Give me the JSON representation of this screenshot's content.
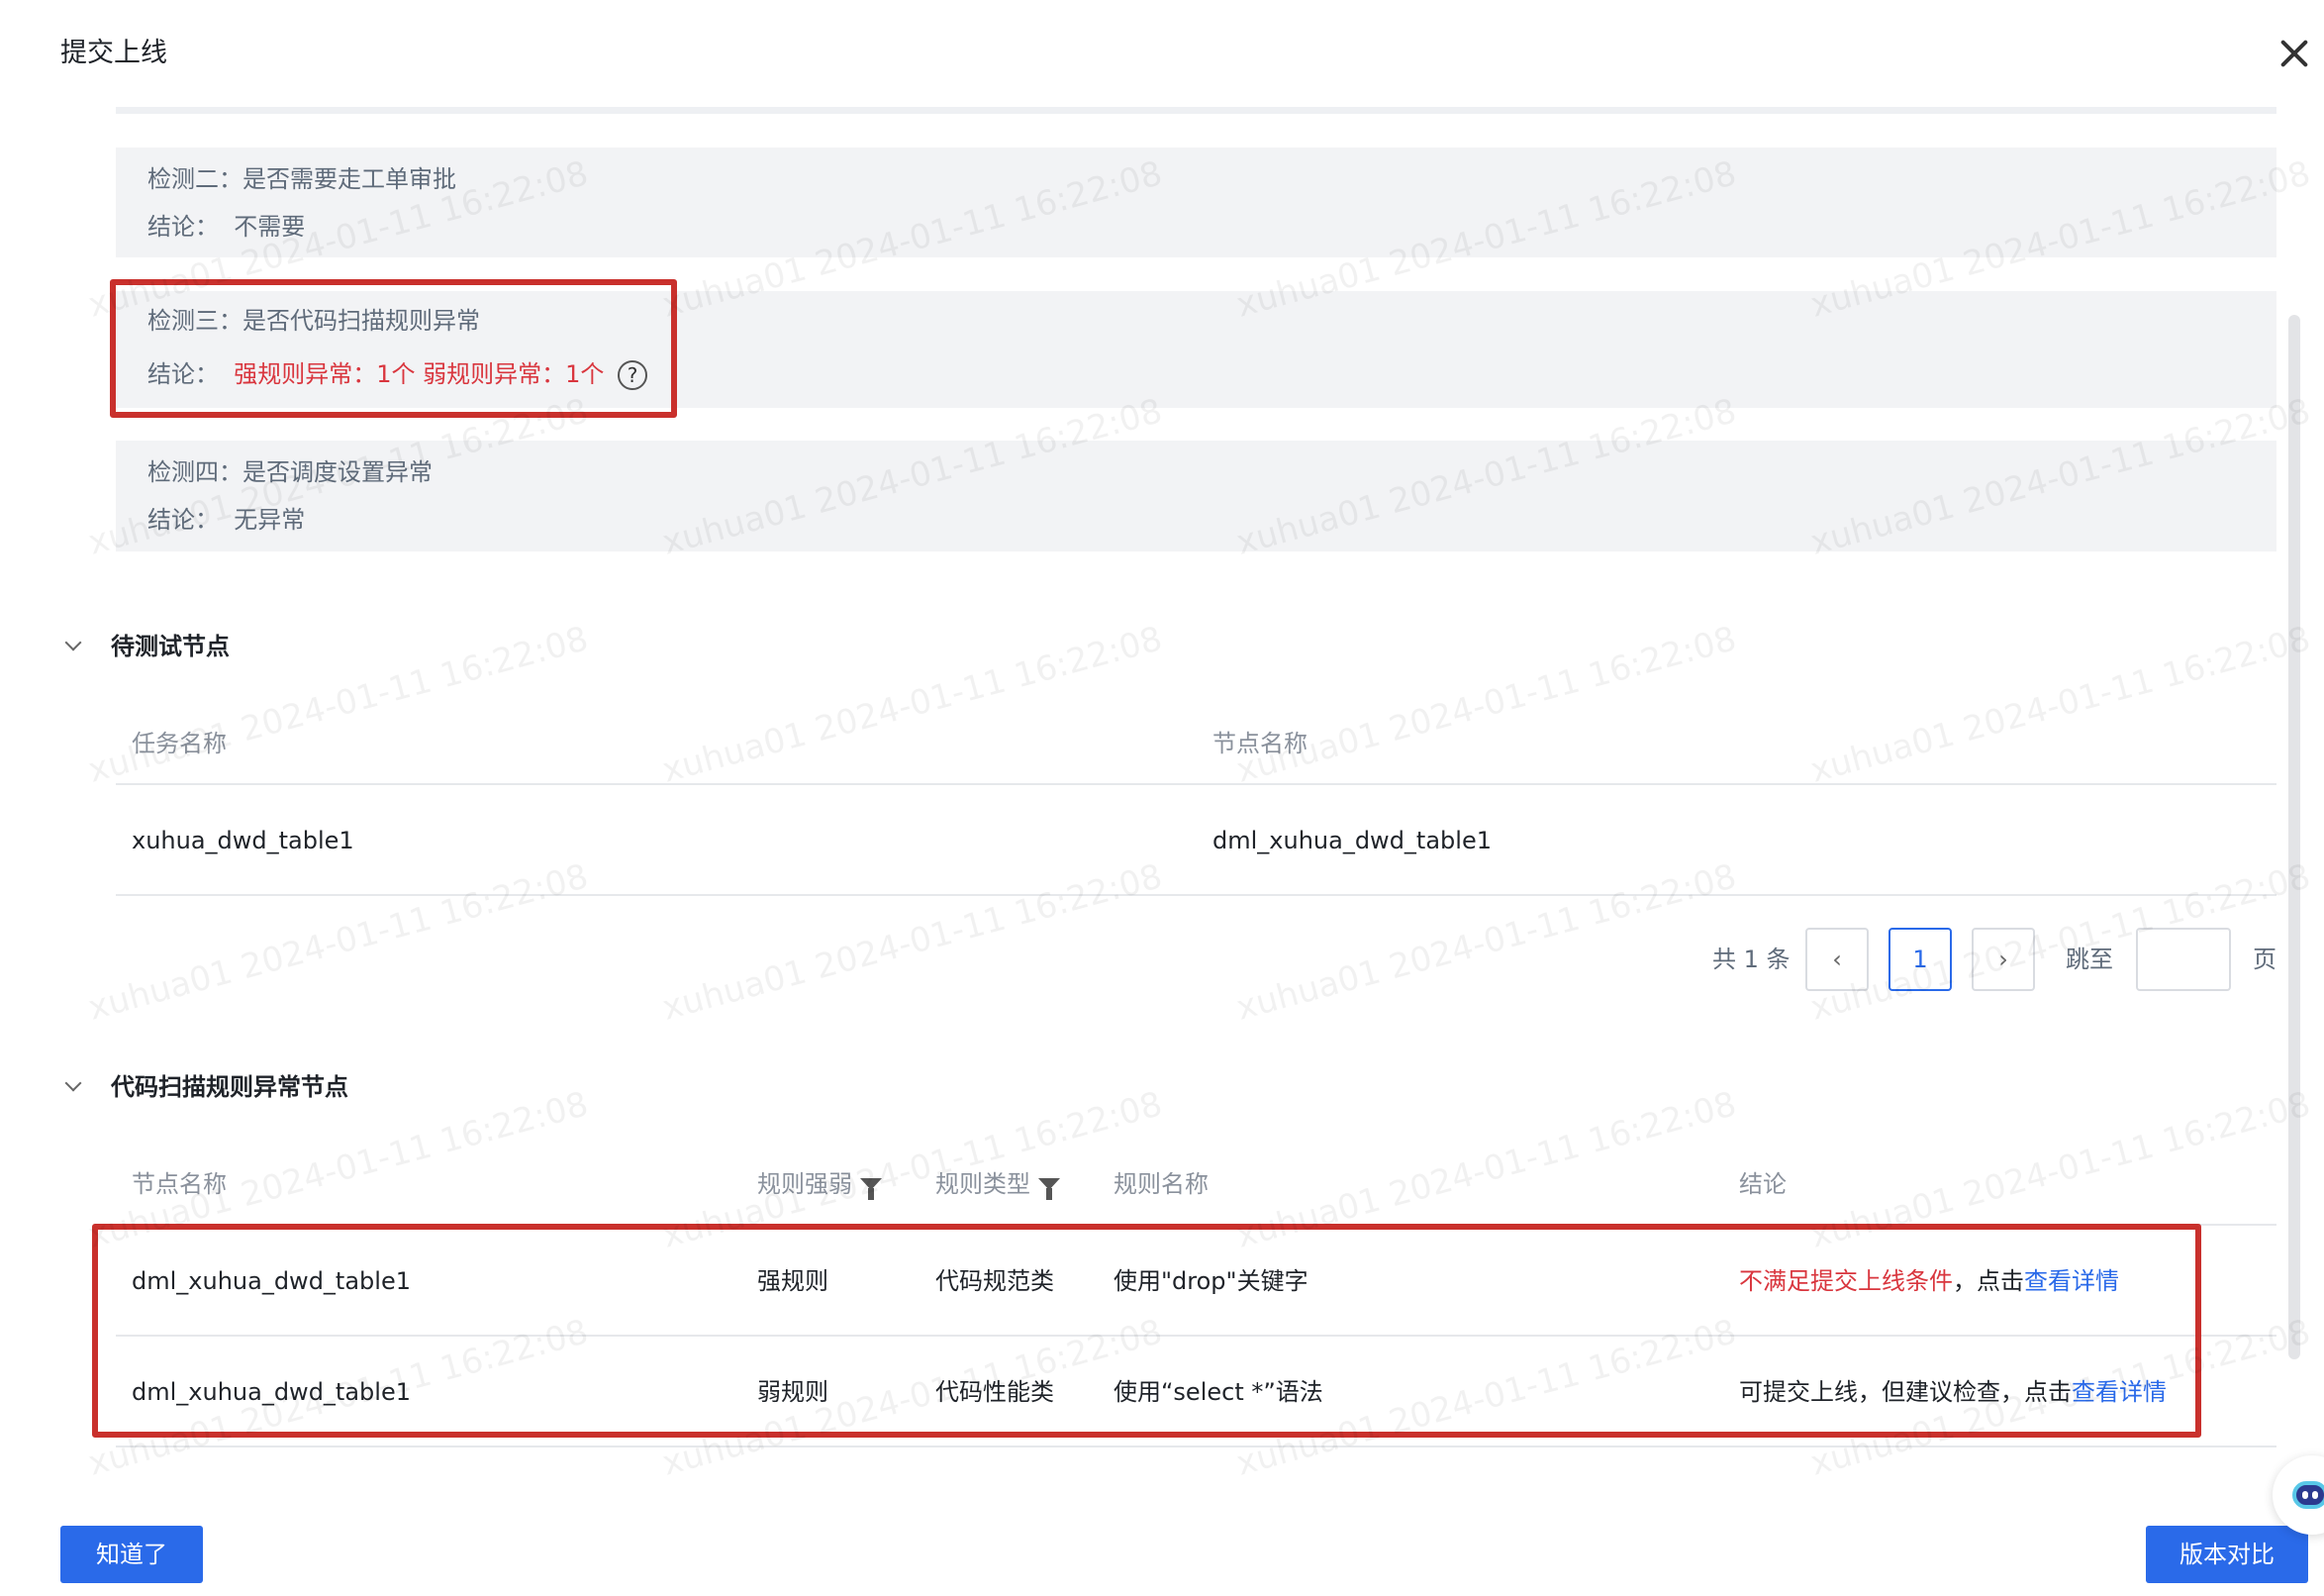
{
  "dialog": {
    "title": "提交上线"
  },
  "checks": [
    {
      "label": "检测二：是否需要走工单审批",
      "conclusion_label": "结论：",
      "conclusion": "不需要"
    },
    {
      "label": "检测三：是否代码扫描规则异常",
      "conclusion_label": "结论：",
      "conclusion": "强规则异常：1个 弱规则异常：1个",
      "help_icon": "question-circle-icon"
    },
    {
      "label": "检测四：是否调度设置异常",
      "conclusion_label": "结论：",
      "conclusion": "无异常"
    }
  ],
  "pending_section": {
    "title": "待测试节点",
    "columns": [
      "任务名称",
      "节点名称"
    ],
    "rows": [
      [
        "xuhua_dwd_table1",
        "dml_xuhua_dwd_table1"
      ]
    ],
    "pagination": {
      "total_text": "共 1 条",
      "current_page": "1",
      "jump_label": "跳至",
      "page_suffix": "页",
      "prev_glyph": "‹",
      "next_glyph": "›"
    }
  },
  "scan_section": {
    "title": "代码扫描规则异常节点",
    "columns": [
      "节点名称",
      "规则强弱",
      "规则类型",
      "规则名称",
      "结论"
    ],
    "rows": [
      {
        "node": "dml_xuhua_dwd_table1",
        "strength": "强规则",
        "type": "代码规范类",
        "rule": "使用\"drop\"关键字",
        "conclusion_prefix": "不满足提交上线条件",
        "conclusion_mid": "，点击",
        "link": "查看详情"
      },
      {
        "node": "dml_xuhua_dwd_table1",
        "strength": "弱规则",
        "type": "代码性能类",
        "rule": "使用“select *”语法",
        "conclusion_prefix": "可提交上线，但建议检查，点击",
        "conclusion_mid": "",
        "link": "查看详情"
      }
    ]
  },
  "footer": {
    "ok_label": "知道了",
    "compare_label": "版本对比"
  },
  "watermark_text": "xuhua01 2024-01-11 16:22:08",
  "colors": {
    "primary": "#2a6ae9",
    "error": "#d9363e",
    "highlight": "#c9302c",
    "panel_bg": "#f2f3f5"
  }
}
